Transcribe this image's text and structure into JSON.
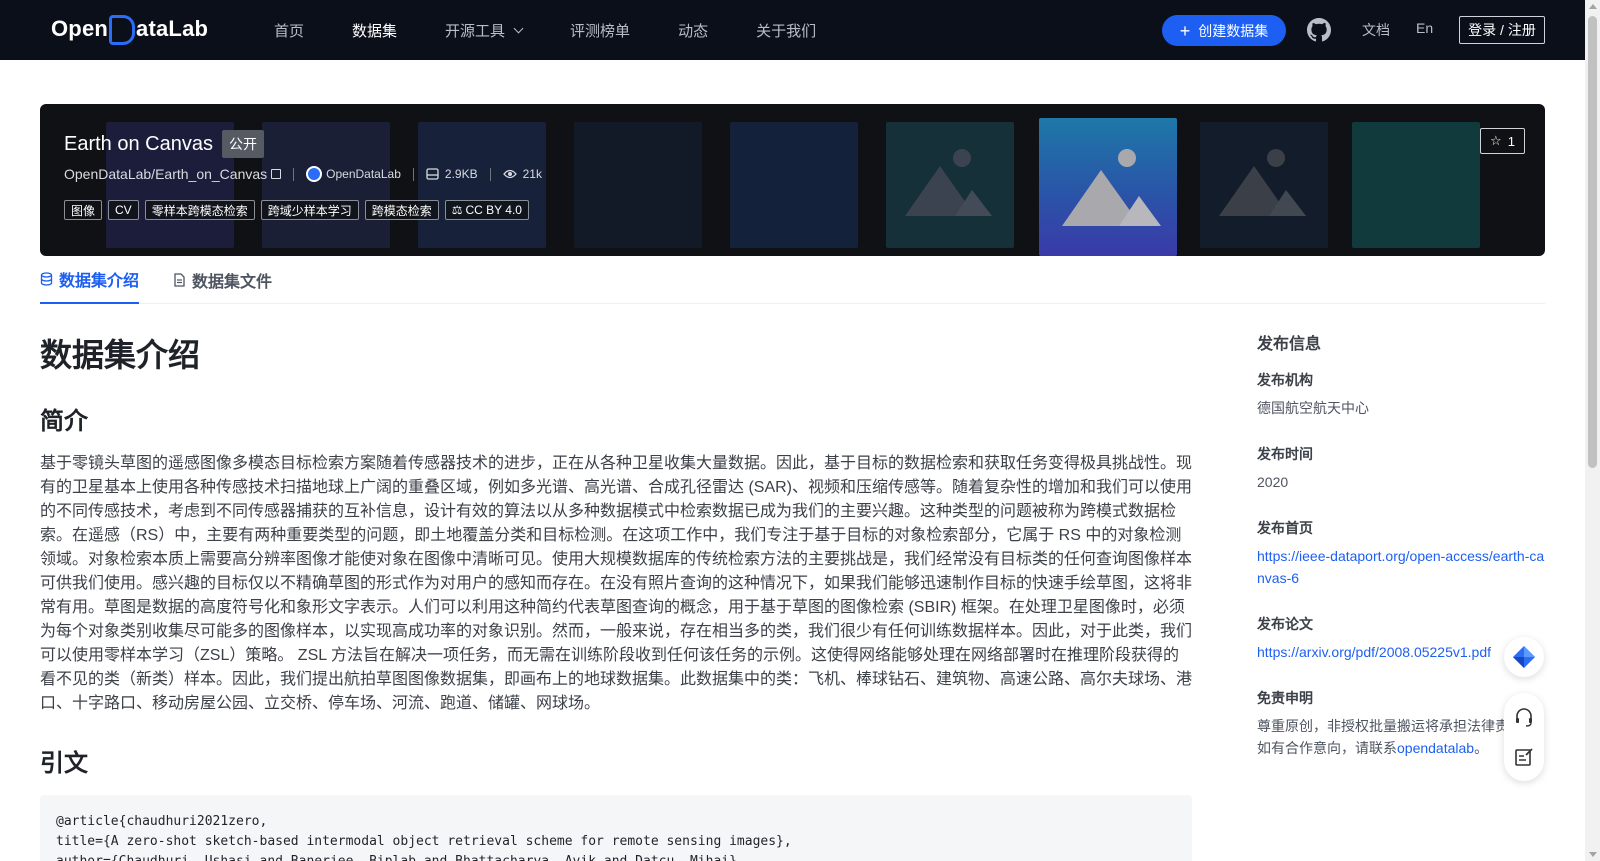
{
  "nav": {
    "logo_pre": "Open",
    "logo_post": "ataLab",
    "items": [
      {
        "label": "首页"
      },
      {
        "label": "数据集"
      },
      {
        "label": "开源工具"
      },
      {
        "label": "评测榜单"
      },
      {
        "label": "动态"
      },
      {
        "label": "关于我们"
      }
    ],
    "create_label": "创建数据集",
    "docs_label": "文档",
    "lang_label": "En",
    "login_label": "登录 / 注册",
    "accent_color": "#1d5ff2"
  },
  "banner": {
    "title": "Earth on Canvas",
    "visibility": "公开",
    "repo_path": "OpenDataLab/Earth_on_Canvas",
    "org": "OpenDataLab",
    "size": "2.9KB",
    "views": "21k",
    "tags": [
      "图像",
      "CV",
      "零样本跨模态检索",
      "跨域少样本学习",
      "跨模态检索"
    ],
    "license": "CC BY 4.0",
    "stars": "1"
  },
  "tabs": [
    {
      "label": "数据集介绍",
      "icon": "database-icon"
    },
    {
      "label": "数据集文件",
      "icon": "file-icon"
    }
  ],
  "content": {
    "heading": "数据集介绍",
    "section_intro": "简介",
    "intro_text": "基于零镜头草图的遥感图像多模态目标检索方案随着传感器技术的进步，正在从各种卫星收集大量数据。因此，基于目标的数据检索和获取任务变得极具挑战性。现有的卫星基本上使用各种传感技术扫描地球上广阔的重叠区域，例如多光谱、高光谱、合成孔径雷达 (SAR)、视频和压缩传感等。随着复杂性的增加和我们可以使用的不同传感技术，考虑到不同传感器捕获的互补信息，设计有效的算法以从多种数据模式中检索数据已成为我们的主要兴趣。这种类型的问题被称为跨模式数据检索。在遥感（RS）中，主要有两种重要类型的问题，即土地覆盖分类和目标检测。在这项工作中，我们专注于基于目标的对象检索部分，它属于 RS 中的对象检测领域。对象检索本质上需要高分辨率图像才能使对象在图像中清晰可见。使用大规模数据库的传统检索方法的主要挑战是，我们经常没有目标类的任何查询图像样本可供我们使用。感兴趣的目标仅以不精确草图的形式作为对用户的感知而存在。在没有照片查询的这种情况下，如果我们能够迅速制作目标的快速手绘草图，这将非常有用。草图是数据的高度符号化和象形文字表示。人们可以利用这种简约代表草图查询的概念，用于基于草图的图像检索 (SBIR) 框架。在处理卫星图像时，必须为每个对象类别收集尽可能多的图像样本，以实现高成功率的对象识别。然而，一般来说，存在相当多的类，我们很少有任何训练数据样本。因此，对于此类，我们可以使用零样本学习（ZSL）策略。 ZSL 方法旨在解决一项任务，而无需在训练阶段收到任何该任务的示例。这使得网络能够处理在网络部署时在推理阶段获得的看不见的类（新类）样本。因此，我们提出航拍草图图像数据集，即画布上的地球数据集。此数据集中的类：飞机、棒球钻石、建筑物、高速公路、高尔夫球场、港口、十字路口、移动房屋公园、立交桥、停车场、河流、跑道、储罐、网球场。",
    "section_cite": "引文",
    "citation": "@article{chaudhuri2021zero,\ntitle={A zero-shot sketch-based intermodal object retrieval scheme for remote sensing images},\nauthor={Chaudhuri, Ushasi and Banerjee, Biplab and Bhattacharya, Avik and Datcu, Mihai},"
  },
  "sidebar": {
    "title": "发布信息",
    "publisher_label": "发布机构",
    "publisher": "德国航空航天中心",
    "time_label": "发布时间",
    "time": "2020",
    "homepage_label": "发布首页",
    "homepage": "https://ieee-dataport.org/open-access/earth-canvas-6",
    "paper_label": "发布论文",
    "paper": "https://arxiv.org/pdf/2008.05225v1.pdf",
    "disclaimer_label": "免责申明",
    "disclaimer_prefix": "尊重原创，非授权批量搬运将承担法律责任；如有合作意向，请联系",
    "disclaimer_link": "opendatalab",
    "disclaimer_suffix": "。"
  }
}
